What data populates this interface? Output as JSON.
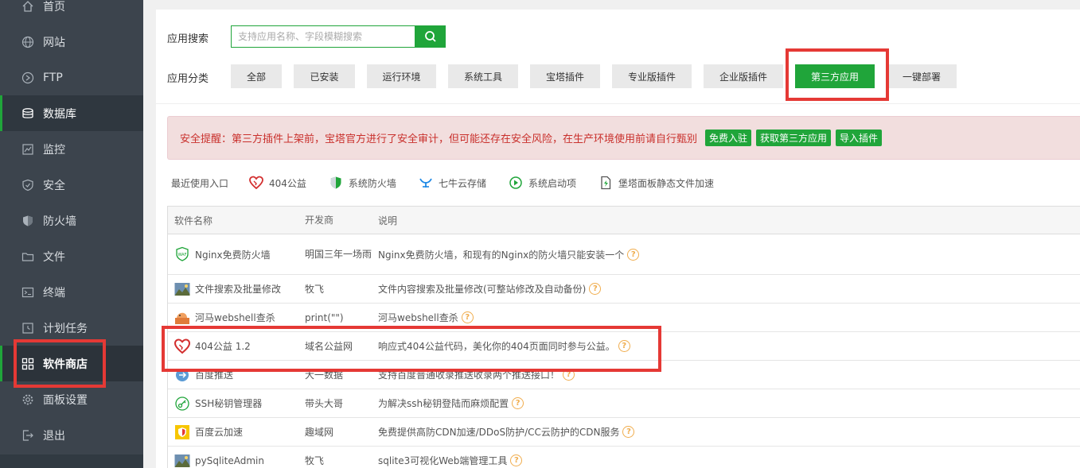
{
  "sidebar": {
    "items": [
      {
        "label": "首页",
        "icon": "home-icon"
      },
      {
        "label": "网站",
        "icon": "globe-icon"
      },
      {
        "label": "FTP",
        "icon": "ftp-icon"
      },
      {
        "label": "数据库",
        "icon": "database-icon"
      },
      {
        "label": "监控",
        "icon": "monitor-icon"
      },
      {
        "label": "安全",
        "icon": "shield-icon"
      },
      {
        "label": "防火墙",
        "icon": "firewall-icon"
      },
      {
        "label": "文件",
        "icon": "folder-icon"
      },
      {
        "label": "终端",
        "icon": "terminal-icon"
      },
      {
        "label": "计划任务",
        "icon": "clock-icon"
      },
      {
        "label": "软件商店",
        "icon": "grid-icon"
      },
      {
        "label": "面板设置",
        "icon": "gear-icon"
      },
      {
        "label": "退出",
        "icon": "logout-icon"
      }
    ]
  },
  "search": {
    "label": "应用搜索",
    "placeholder": "支持应用名称、字段模糊搜索"
  },
  "categories": {
    "label": "应用分类",
    "items": [
      "全部",
      "已安装",
      "运行环境",
      "系统工具",
      "宝塔插件",
      "专业版插件",
      "企业版插件",
      "第三方应用",
      "一键部署"
    ],
    "active": "第三方应用"
  },
  "alert": {
    "text": "安全提醒：第三方插件上架前，宝塔官方进行了安全审计，但可能还存在安全风险，在生产环境使用前请自行甄别",
    "buttons": [
      "免费入驻",
      "获取第三方应用",
      "导入插件"
    ]
  },
  "recent": {
    "label": "最近使用入口",
    "items": [
      "404公益",
      "系统防火墙",
      "七牛云存储",
      "系统启动项",
      "堡塔面板静态文件加速"
    ]
  },
  "table": {
    "headers": [
      "软件名称",
      "开发商",
      "说明"
    ],
    "rows": [
      {
        "name": "Nginx免费防火墙",
        "vendor": "明国三年一场雨",
        "desc": "Nginx免费防火墙，和现有的Nginx的防火墙只能安装一个"
      },
      {
        "name": "文件搜索及批量修改",
        "vendor": "牧飞",
        "desc": "文件内容搜索及批量修改(可整站修改及自动备份)"
      },
      {
        "name": "河马webshell查杀",
        "vendor": "print(\"\")",
        "desc": "河马webshell查杀"
      },
      {
        "name": "404公益 1.2",
        "vendor": "域名公益网",
        "desc": "响应式404公益代码，美化你的404页面同时参与公益。"
      },
      {
        "name": "百度推送",
        "vendor": "大一数据",
        "desc": "支持百度普通收录推送收录两个推送接口！"
      },
      {
        "name": "SSH秘钥管理器",
        "vendor": "带头大哥",
        "desc": "为解决ssh秘钥登陆而麻烦配置"
      },
      {
        "name": "百度云加速",
        "vendor": "趣域网",
        "desc": "免费提供高防CDN加速/DDoS防护/CC云防护的CDN服务"
      },
      {
        "name": "pySqliteAdmin",
        "vendor": "牧飞",
        "desc": "sqlite3可视化Web端管理工具"
      }
    ]
  },
  "help_glyph": "?",
  "colors": {
    "accent": "#20a53a",
    "sidebar": "#3c444d",
    "alert_text": "#c9302c",
    "annotation": "#e53935"
  }
}
